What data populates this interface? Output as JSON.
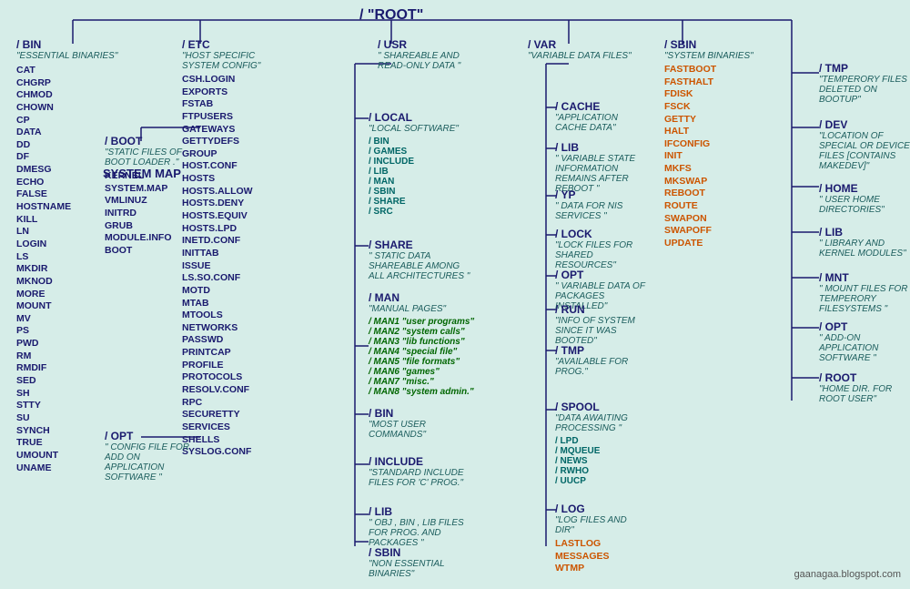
{
  "title": "/ \"ROOT\"",
  "watermark": "gaanagaa.blogspot.com",
  "nodes": {
    "root": {
      "label": "/ \"ROOT\""
    },
    "bin": {
      "title": "/ BIN",
      "desc": "\"ESSENTIAL BINARIES\"",
      "items": [
        "CAT",
        "CHGRP",
        "CHMOD",
        "CHOWN",
        "CP",
        "DATA",
        "DD",
        "DF",
        "DMESG",
        "ECHO",
        "FALSE",
        "HOSTNAME",
        "KILL",
        "LN",
        "LOGIN",
        "LS",
        "MKDIR",
        "MKNOD",
        "MORE",
        "MOUNT",
        "MV",
        "PS",
        "PWD",
        "RM",
        "RMDIF",
        "SED",
        "SH",
        "STTY",
        "SU",
        "SYNCH",
        "TRUE",
        "UMOUNT",
        "UNAME"
      ]
    },
    "etc": {
      "title": "/ ETC",
      "desc": "\"HOST SPECIFIC SYSTEM CONFIG\"",
      "items": [
        "CSH.LOGIN",
        "EXPORTS",
        "FSTAB",
        "FTPUSERS",
        "GATEWAYS",
        "GETTYDEFS",
        "GROUP",
        "HOST.CONF",
        "HOSTS",
        "HOSTS.ALLOW",
        "HOSTS.DENY",
        "HOSTS.EQUIV",
        "HOSTS.LPD",
        "INETD.CONF",
        "INITTAB",
        "ISSUE",
        "LS.SO.CONF",
        "MOTD",
        "MTAB",
        "MTOOLS",
        "NETWORKS",
        "PASSWD",
        "PRINTCAP",
        "PROFILE",
        "PROTOCOLS",
        "RESOLV.CONF",
        "RPC",
        "SECURETTY",
        "SERVICES",
        "SHELLS",
        "SYSLOG.CONF"
      ]
    },
    "etc_opt": {
      "title": "/ OPT",
      "desc": "\" CONFIG FILE FOR ADD ON APPLICATION SOFTWARE \""
    },
    "boot": {
      "title": "/ BOOT",
      "desc": "\"STATIC FILES OF BOOT LOADER .\"",
      "items": [
        "KERNEL",
        "SYSTEM.MAP",
        "VMLINUZ",
        "INITRD",
        "GRUB",
        "MODULE.INFO",
        "BOOT"
      ]
    },
    "usr": {
      "title": "/ USR",
      "desc": "\" SHAREABLE AND READ-ONLY DATA \""
    },
    "usr_local": {
      "title": "/ LOCAL",
      "desc": "\"LOCAL SOFTWARE\"",
      "subitems": [
        "/ BIN",
        "/ GAMES",
        "/ INCLUDE",
        "/ LIB",
        "/ MAN",
        "/ SBIN",
        "/ SHARE",
        "/ SRC"
      ]
    },
    "usr_share": {
      "title": "/ SHARE",
      "desc": "\" STATIC DATA SHAREABLE AMONG ALL ARCHITECTURES \""
    },
    "usr_man": {
      "title": "/ MAN",
      "desc": "\"MANUAL PAGES\"",
      "subitems": [
        "/ MAN1 \"user programs\"",
        "/ MAN2 \"system calls\"",
        "/ MAN3 \"lib functions\"",
        "/ MAN4 \"special file\"",
        "/ MAN5 \"file formats\"",
        "/ MAN6 \"games\"",
        "/ MAN7 \"misc.\"",
        "/ MAN8 \"system admin.\""
      ]
    },
    "usr_bin": {
      "title": "/ BIN",
      "desc": "\"MOST USER COMMANDS\""
    },
    "usr_include": {
      "title": "/ INCLUDE",
      "desc": "\"STANDARD INCLUDE FILES FOR 'C' PROG.\""
    },
    "usr_lib": {
      "title": "/ LIB",
      "desc": "\" OBJ , BIN , LIB FILES FOR PROG. AND PACKAGES \""
    },
    "usr_sbin": {
      "title": "/ SBIN",
      "desc": "\"NON ESSENTIAL BINARIES\""
    },
    "var": {
      "title": "/ VAR",
      "desc": "\"VARIABLE DATA FILES\""
    },
    "var_cache": {
      "title": "/ CACHE",
      "desc": "\"APPLICATION CACHE DATA\""
    },
    "var_lib": {
      "title": "/ LIB",
      "desc": "\" VARIABLE STATE INFORMATION REMAINS AFTER REBOOT \""
    },
    "var_yp": {
      "title": "/ YP",
      "desc": "\"  DATA FOR NIS SERVICES \""
    },
    "var_lock": {
      "title": "/ LOCK",
      "desc": "\"LOCK FILES FOR SHARED RESOURCES\""
    },
    "var_opt": {
      "title": "/ OPT",
      "desc": "\"  VARIABLE DATA OF PACKAGES INSTALLED\""
    },
    "var_run": {
      "title": "/ RUN",
      "desc": "\"INFO OF SYSTEM SINCE IT WAS BOOTED\""
    },
    "var_tmp": {
      "title": "/ TMP",
      "desc": "\"AVAILABLE FOR PROG.\""
    },
    "var_spool": {
      "title": "/ SPOOL",
      "desc": "\"DATA AWAITING PROCESSING \"",
      "subitems": [
        "/ LPD",
        "/ MQUEUE",
        "/ NEWS",
        "/ RWHO",
        "/ UUCP"
      ]
    },
    "var_log": {
      "title": "/ LOG",
      "desc": "\"LOG FILES AND DIR\"",
      "orange_items": [
        "LASTLOG",
        "MESSAGES",
        "WTMP"
      ]
    },
    "sbin": {
      "title": "/ SBIN",
      "desc": "\"SYSTEM BINARIES\"",
      "orange_items": [
        "FASTBOOT",
        "FASTHALT",
        "FDISK",
        "FSCK",
        "GETTY",
        "HALT",
        "IFCONFIG",
        "INIT",
        "MKFS",
        "MKSWAP",
        "REBOOT",
        "ROUTE",
        "SWAPON",
        "SWAPOFF",
        "UPDATE"
      ]
    },
    "tmp": {
      "title": "/ TMP",
      "desc": "\"TEMPERORY FILES DELETED ON BOOTUP\""
    },
    "dev": {
      "title": "/ DEV",
      "desc": "\"LOCATION OF SPECIAL OR DEVICE FILES [CONTAINS MAKEDEV]\""
    },
    "home": {
      "title": "/ HOME",
      "desc": "\" USER HOME DIRECTORIES\""
    },
    "lib": {
      "title": "/ LIB",
      "desc": "\"  LIBRARY AND KERNEL MODULES\""
    },
    "mnt": {
      "title": "/ MNT",
      "desc": "\"  MOUNT FILES FOR TEMPERORY FILESYSTEMS \""
    },
    "opt": {
      "title": "/ OPT",
      "desc": "\" ADD-ON APPLICATION SOFTWARE \""
    },
    "root_home": {
      "title": "/ ROOT",
      "desc": "\"HOME DIR. FOR ROOT USER\""
    }
  }
}
